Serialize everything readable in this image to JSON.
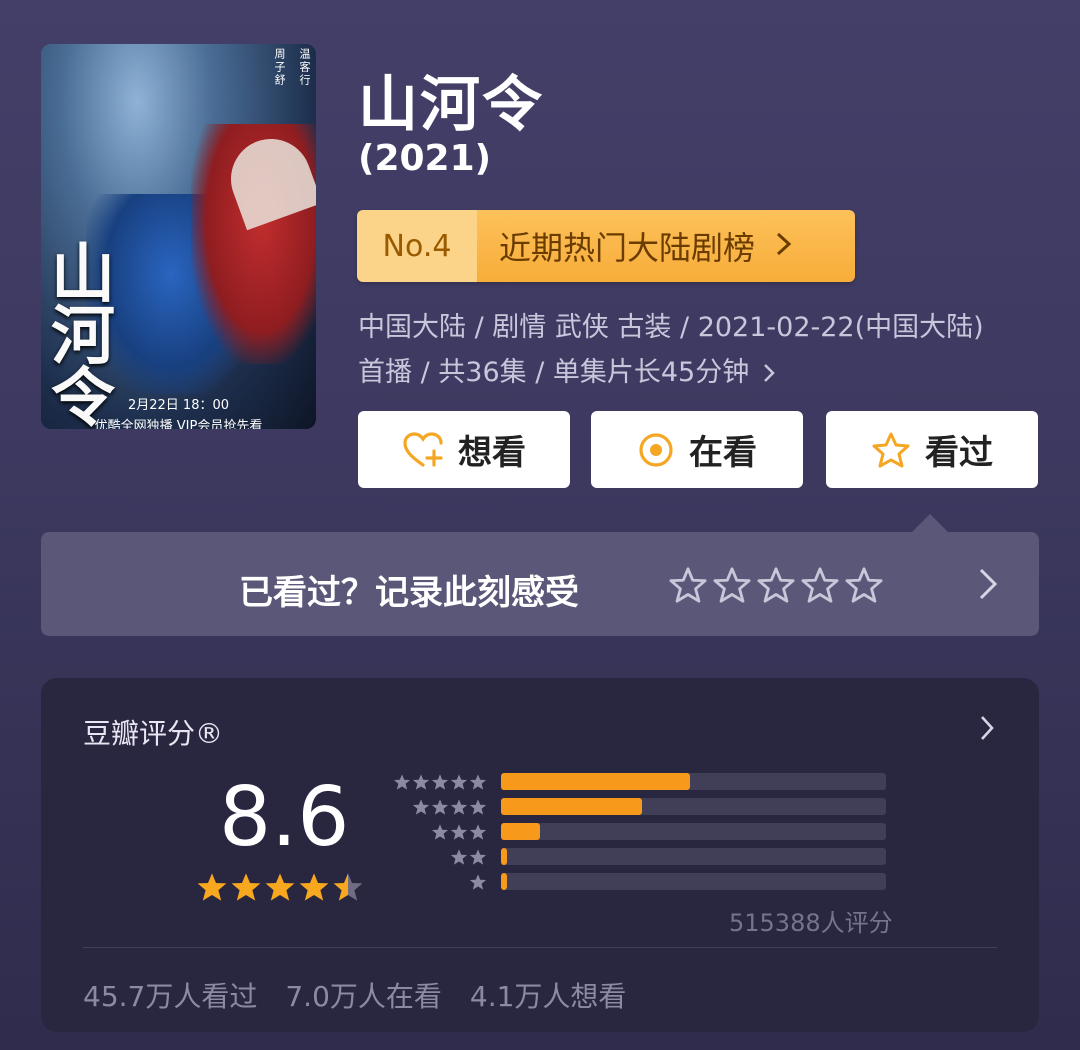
{
  "poster": {
    "calligraphy": "山河令",
    "actor1": "周子舒",
    "actor2": "温客行",
    "date_line": "2月22日 18：00",
    "platform_line": "优酷全网独播 VIP会员抢先看"
  },
  "title": "山河令",
  "year": "(2021)",
  "rank": {
    "no": "No.4",
    "label": "近期热门大陆剧榜"
  },
  "meta": {
    "line1": "中国大陆 / 剧情 武侠 古装 / 2021-02-22(中国大陆)",
    "line2": "首播 / 共36集 / 单集片长45分钟"
  },
  "buttons": {
    "want": "想看",
    "watching": "在看",
    "watched": "看过"
  },
  "record": {
    "prompt": "已看过？记录此刻感受",
    "star_count": 5
  },
  "rating": {
    "title": "豆瓣评分®",
    "score": "8.6",
    "stars": 4.5,
    "distribution": [
      {
        "stars": 5,
        "percent": 49
      },
      {
        "stars": 4,
        "percent": 36.5
      },
      {
        "stars": 3,
        "percent": 10
      },
      {
        "stars": 2,
        "percent": 1.5
      },
      {
        "stars": 1,
        "percent": 1.5
      }
    ],
    "count_text": "515388人评分",
    "stats": [
      "45.7万人看过",
      "7.0万人在看",
      "4.1万人想看"
    ]
  },
  "colors": {
    "accent": "#f79a1c",
    "rank_bg": "#fdc15a",
    "card_bg": "#29263f"
  }
}
